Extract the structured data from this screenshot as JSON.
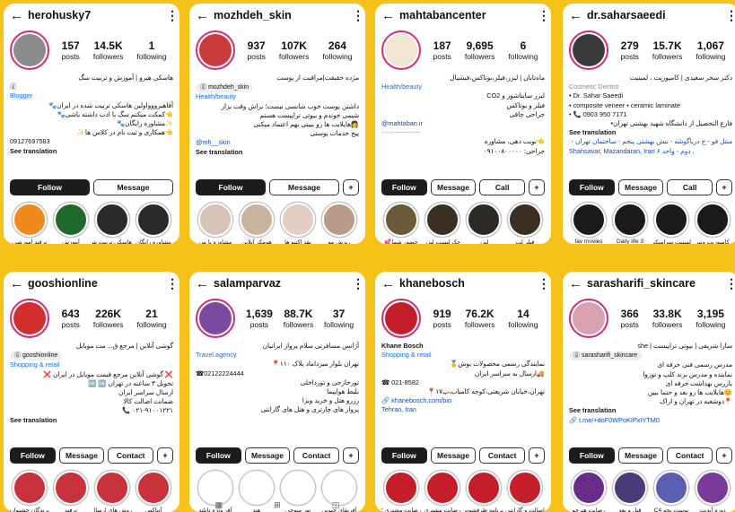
{
  "common": {
    "followers": "followers",
    "following": "following",
    "posts": "posts",
    "see_translation": "See translation",
    "follow": "Follow",
    "message": "Message",
    "contact": "Contact",
    "call": "Call"
  },
  "cards": [
    {
      "username": "herohusky7",
      "posts": "157",
      "followers": "14.5K",
      "following": "1",
      "bio": [
        {
          "t": "هاسکی هیرو | آموزش و تربیت سگ",
          "cls": "rtl"
        },
        {
          "t": "ⓖ",
          "cls": ""
        },
        {
          "t": "Blogger",
          "cls": "cat"
        },
        {
          "t": "آقاهیرووواولین هاسکی تربیت شده در ایران🐾",
          "cls": "rtl"
        },
        {
          "t": "👈کمکت میکنم سگ با ادب داشته باشی🐾",
          "cls": "rtl"
        },
        {
          "t": "✨مشاوره رایگان🐾",
          "cls": "rtl"
        },
        {
          "t": "👈همکاری و ثبت نام در کلاس ها✨",
          "cls": "rtl"
        },
        {
          "t": "09127697583",
          "cls": ""
        },
        {
          "t": "See translation",
          "cls": "trans"
        }
      ],
      "buttons": [
        "Follow",
        "Message"
      ],
      "highlights": [
        {
          "label": "ترفند آموزشی",
          "color": "#f08a1c"
        },
        {
          "label": "آموزش",
          "color": "#1f6a2c"
        },
        {
          "label": "هاسکی تربیت شده",
          "color": "#2a2a2a"
        },
        {
          "label": "مشاوره رایگان",
          "color": "#2a2a2a"
        }
      ]
    },
    {
      "username": "mozhdeh_skin",
      "posts": "937",
      "followers": "107K",
      "following": "264",
      "bio": [
        {
          "t": "مژده حقیقت|مراقبت از پوست",
          "cls": "rtl"
        },
        {
          "t": "ⓖ mozhdeh_skin",
          "cls": "badge"
        },
        {
          "t": "Health/beauty",
          "cls": "cat"
        },
        {
          "t": "داشتن پوست خوب شانسی نیست؛ براش وقت بزار",
          "cls": "rtl"
        },
        {
          "t": "شیمی خوندم و بیوتی تراپیست هستم",
          "cls": "rtl"
        },
        {
          "t": "👩هایلایت ها رو ببینی بهم اعتماد میکنی",
          "cls": "rtl"
        },
        {
          "t": "پیج خدمات پوستی",
          "cls": "rtl"
        },
        {
          "t": "@mh__skin",
          "cls": "link"
        },
        {
          "t": "See translation",
          "cls": "trans"
        }
      ],
      "buttons": [
        "Follow",
        "Message",
        "+"
      ],
      "highlights": [
        {
          "label": "مشاوره با من",
          "color": "#d8c3b8"
        },
        {
          "label": "هومکر آنلاین",
          "color": "#c9b59f"
        },
        {
          "label": "نقد اکتیو ها",
          "color": "#e2cfc2"
        },
        {
          "label": "ریزش مو",
          "color": "#b89c88"
        }
      ]
    },
    {
      "username": "mahtabancenter",
      "posts": "187",
      "followers": "9,695",
      "following": "6",
      "bio": [
        {
          "t": "ماه‌تابان | لیزر،فیلر،بوتاکس،فیشیال",
          "cls": "rtl"
        },
        {
          "t": "Health/beauty",
          "cls": "cat"
        },
        {
          "t": "لیزر سایناشور و CO2",
          "cls": "rtl"
        },
        {
          "t": "فیلر و بوتاکس",
          "cls": "rtl"
        },
        {
          "t": "جراحی چاقی",
          "cls": "rtl"
        },
        {
          "t": "@mahtaban.ir",
          "cls": "link"
        },
        {
          "t": "------------------",
          "cls": "muted"
        },
        {
          "t": "👈نوبت دهی، مشاوره",
          "cls": "rtl"
        },
        {
          "t": "جراحی: ۰۹۱۰۰۸۰۰۰۰۰",
          "cls": "rtl"
        }
      ],
      "buttons": [
        "Follow",
        "Message",
        "Call",
        "+"
      ],
      "highlights": [
        {
          "label": "حضور شما💕",
          "color": "#6b5a3a"
        },
        {
          "label": "چک لیست لیزر",
          "color": "#3a3024"
        },
        {
          "label": "لیزر",
          "color": "#2d2a26"
        },
        {
          "label": "فیلر لب",
          "color": "#3b2f22"
        }
      ]
    },
    {
      "username": "dr.saharsaeedi",
      "posts": "279",
      "followers": "15.7K",
      "following": "1,067",
      "bio": [
        {
          "t": "دکتر سحر سعیدی | کامپوزیت ، لمینیت",
          "cls": "rtl"
        },
        {
          "t": "Cosmetic Dentist",
          "cls": "muted"
        },
        {
          "t": "• Dr. Sahar Saeedi",
          "cls": ""
        },
        {
          "t": "• composite veneer • ceramic laminate",
          "cls": ""
        },
        {
          "t": "• 📞 0903 950 7171",
          "cls": ""
        },
        {
          "t": "فارغ التحصیل از دانشگاه شهید بهشتی تهران•",
          "cls": "rtl"
        },
        {
          "t": "See translation",
          "cls": "trans"
        },
        {
          "t": "منتل قو - خ دریاگوشه - نبش بهشتی پنجم - ساختمان تهران - ط",
          "cls": "link rtl"
        },
        {
          "t": "Shahsavar, Mazandaran, Iran دوم - واحد ۶ ,",
          "cls": "link"
        }
      ],
      "buttons": [
        "Follow",
        "Message",
        "Call",
        "+"
      ],
      "highlights": [
        {
          "label": "fav movies",
          "color": "#1a1a1a"
        },
        {
          "label": "Daily life 3",
          "color": "#1a1a1a"
        },
        {
          "label": "لمینیت سرامیکی",
          "color": "#1a1a1a"
        },
        {
          "label": "کامپوزیت ونیر",
          "color": "#1a1a1a"
        }
      ]
    },
    {
      "username": "gooshionline",
      "posts": "643",
      "followers": "226K",
      "following": "21",
      "bio": [
        {
          "t": "گوشی آنلاین | مرجع ق... مت موبایل",
          "cls": "rtl"
        },
        {
          "t": "ⓖ gooshionline",
          "cls": "badge"
        },
        {
          "t": "Shopping & retail",
          "cls": "cat"
        },
        {
          "t": "❌ گوشی آنلاین مرجع قیمت موبایل در ایران ❌",
          "cls": "rtl"
        },
        {
          "t": "تحویل ۳ ساعته در تهران 🆗 🆗",
          "cls": "rtl"
        },
        {
          "t": "ارسال سراسر ایران",
          "cls": "rtl"
        },
        {
          "t": "ضمانت اصالت کالا",
          "cls": "rtl"
        },
        {
          "t": "۰۲۱-۹۱۰۰۱۲۲۱ 📞",
          "cls": "rtl"
        },
        {
          "t": "See translation",
          "cls": "trans"
        }
      ],
      "buttons": [
        "Follow",
        "Message",
        "Contact",
        "+"
      ],
      "highlights": [
        {
          "label": "برندگان جشنواره",
          "color": "#c8323c"
        },
        {
          "label": "ترفند",
          "color": "#c8323c"
        },
        {
          "label": "روش های ارسال",
          "color": "#c8323c"
        },
        {
          "label": "آنباکس",
          "color": "#c8323c"
        }
      ]
    },
    {
      "username": "salamparvaz",
      "posts": "1,639",
      "followers": "88.7K",
      "following": "37",
      "bio": [
        {
          "t": "آژانس مسافرتی سلام پرواز ایرانیان",
          "cls": "rtl"
        },
        {
          "t": "Travel agency",
          "cls": "cat"
        },
        {
          "t": "تهران بلوار میرداماد پلاک ۱۱۰📍",
          "cls": "rtl"
        },
        {
          "t": "☎02122224444",
          "cls": ""
        },
        {
          "t": "تورخارجی و تورداخلی",
          "cls": "rtl"
        },
        {
          "t": "بلیط هواپیما",
          "cls": "rtl"
        },
        {
          "t": "رزرو هتل و خرید ویزا",
          "cls": "rtl"
        },
        {
          "t": "پرواز های چارتری و هتل های گارانتی",
          "cls": "rtl"
        },
        {
          "t": "",
          "cls": ""
        }
      ],
      "buttons": [
        "Follow",
        "Message",
        "Contact",
        "+"
      ],
      "highlights": [
        {
          "label": "آفر ویژه تایلند",
          "color": "#ffffff"
        },
        {
          "label": "هند",
          "color": "#ffffff"
        },
        {
          "label": "تور سوچی",
          "color": "#ffffff"
        },
        {
          "label": "آفریقای جنوبی",
          "color": "#ffffff"
        }
      ]
    },
    {
      "username": "khanebosch",
      "posts": "919",
      "followers": "76.2K",
      "following": "14",
      "bio": [
        {
          "t": "Khane Bosch",
          "cls": "name"
        },
        {
          "t": "Shopping & retail",
          "cls": "cat"
        },
        {
          "t": "نمایندگی رسمی محصولات بوش🏅",
          "cls": "rtl"
        },
        {
          "t": "🚚ارسال به سراسر ایران",
          "cls": "rtl"
        },
        {
          "t": "☎ 021-8582",
          "cls": ""
        },
        {
          "t": "تهران،خیابان شریعتی،کوچه کامیاب،پ۱۷📍",
          "cls": "rtl"
        },
        {
          "t": "🔗 khanebosch.com/bio",
          "cls": "link"
        },
        {
          "t": "Tehran, Iran",
          "cls": "link"
        },
        {
          "t": "",
          "cls": ""
        }
      ],
      "buttons": [
        "Follow",
        "Message",
        "Contact",
        "+"
      ],
      "highlights": [
        {
          "label": "رضایت مشتری ۲",
          "color": "#c41e2a"
        },
        {
          "label": "رضایت مشتری",
          "color": "#c41e2a"
        },
        {
          "label": "برنامه ظرفشویی",
          "color": "#c41e2a"
        },
        {
          "label": "اصالت و گارانتی",
          "color": "#c41e2a"
        }
      ]
    },
    {
      "username": "sarasharifi_skincare",
      "posts": "366",
      "followers": "33.8K",
      "following": "3,195",
      "bio": [
        {
          "t": "سارا شریفی | بیوتی تراپیست | she",
          "cls": "rtl"
        },
        {
          "t": "ⓖ sarasharifi_skincare",
          "cls": "badge"
        },
        {
          "t": "مدرس رسمی فنی حرفه ای",
          "cls": "rtl"
        },
        {
          "t": "نماینده و مدرس برند کلپ و توروا",
          "cls": "rtl"
        },
        {
          "t": "بازرس بهداشت حرفه ای",
          "cls": "rtl"
        },
        {
          "t": "😊هایلایت ها رو بعد و حتما ببین",
          "cls": "rtl"
        },
        {
          "t": "📍دوشعبه در تهران و اراک",
          "cls": "rtl"
        },
        {
          "t": "See translation",
          "cls": "trans"
        },
        {
          "t": "🔗 t.me/+doF0WPoKIPxIYTM0",
          "cls": "link"
        }
      ],
      "buttons": [
        "Follow",
        "Message",
        "Contact",
        "+"
      ],
      "highlights": [
        {
          "label": "رضایت هنرجو",
          "color": "#6a2e8a"
        },
        {
          "label": "قبل و بعد",
          "color": "#4a3a7a"
        },
        {
          "label": "پوست بچه C4",
          "color": "#5a5fb0"
        },
        {
          "label": "دوره آپدیت",
          "color": "#7a3a9a"
        }
      ]
    }
  ],
  "navbar": [
    "▦",
    "⊞",
    "◫"
  ]
}
